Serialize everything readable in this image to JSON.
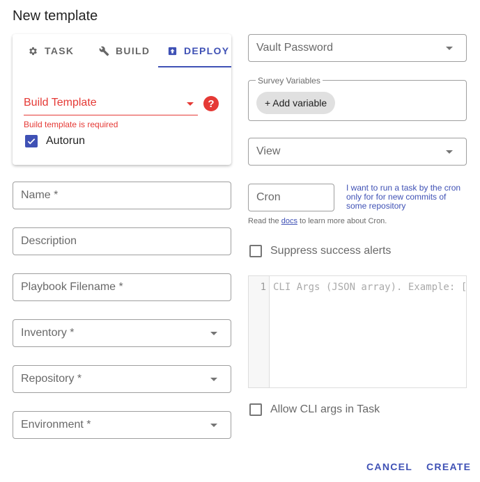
{
  "dialog": {
    "title": "New template"
  },
  "tabs": [
    {
      "label": "TASK",
      "icon": "gear-icon"
    },
    {
      "label": "BUILD",
      "icon": "wrench-icon"
    },
    {
      "label": "DEPLOY",
      "icon": "deploy-icon",
      "active": true
    }
  ],
  "build_template": {
    "label": "Build Template",
    "error": "Build template is required",
    "help_icon": "question-icon"
  },
  "autorun": {
    "label": "Autorun",
    "checked": true
  },
  "fields": {
    "name": "Name *",
    "description": "Description",
    "playbook": "Playbook Filename *",
    "inventory": "Inventory *",
    "repository": "Repository *",
    "environment": "Environment *",
    "vault_password": "Vault Password",
    "view": "View",
    "cron": "Cron"
  },
  "survey": {
    "legend": "Survey Variables",
    "add_button": "+ Add variable"
  },
  "cron": {
    "hint": "I want to run a task by the cron only for for new commits of some repository",
    "docs_prefix": "Read the ",
    "docs_link": "docs",
    "docs_suffix": " to learn more about Cron."
  },
  "suppress_alerts": {
    "label": "Suppress success alerts",
    "checked": false
  },
  "cli_args": {
    "line_number": "1",
    "placeholder": "CLI Args (JSON array). Example: ["
  },
  "allow_cli": {
    "label": "Allow CLI args in Task",
    "checked": false
  },
  "actions": {
    "cancel": "CANCEL",
    "create": "CREATE"
  },
  "colors": {
    "accent": "#3f51b5",
    "error": "#e53935"
  }
}
